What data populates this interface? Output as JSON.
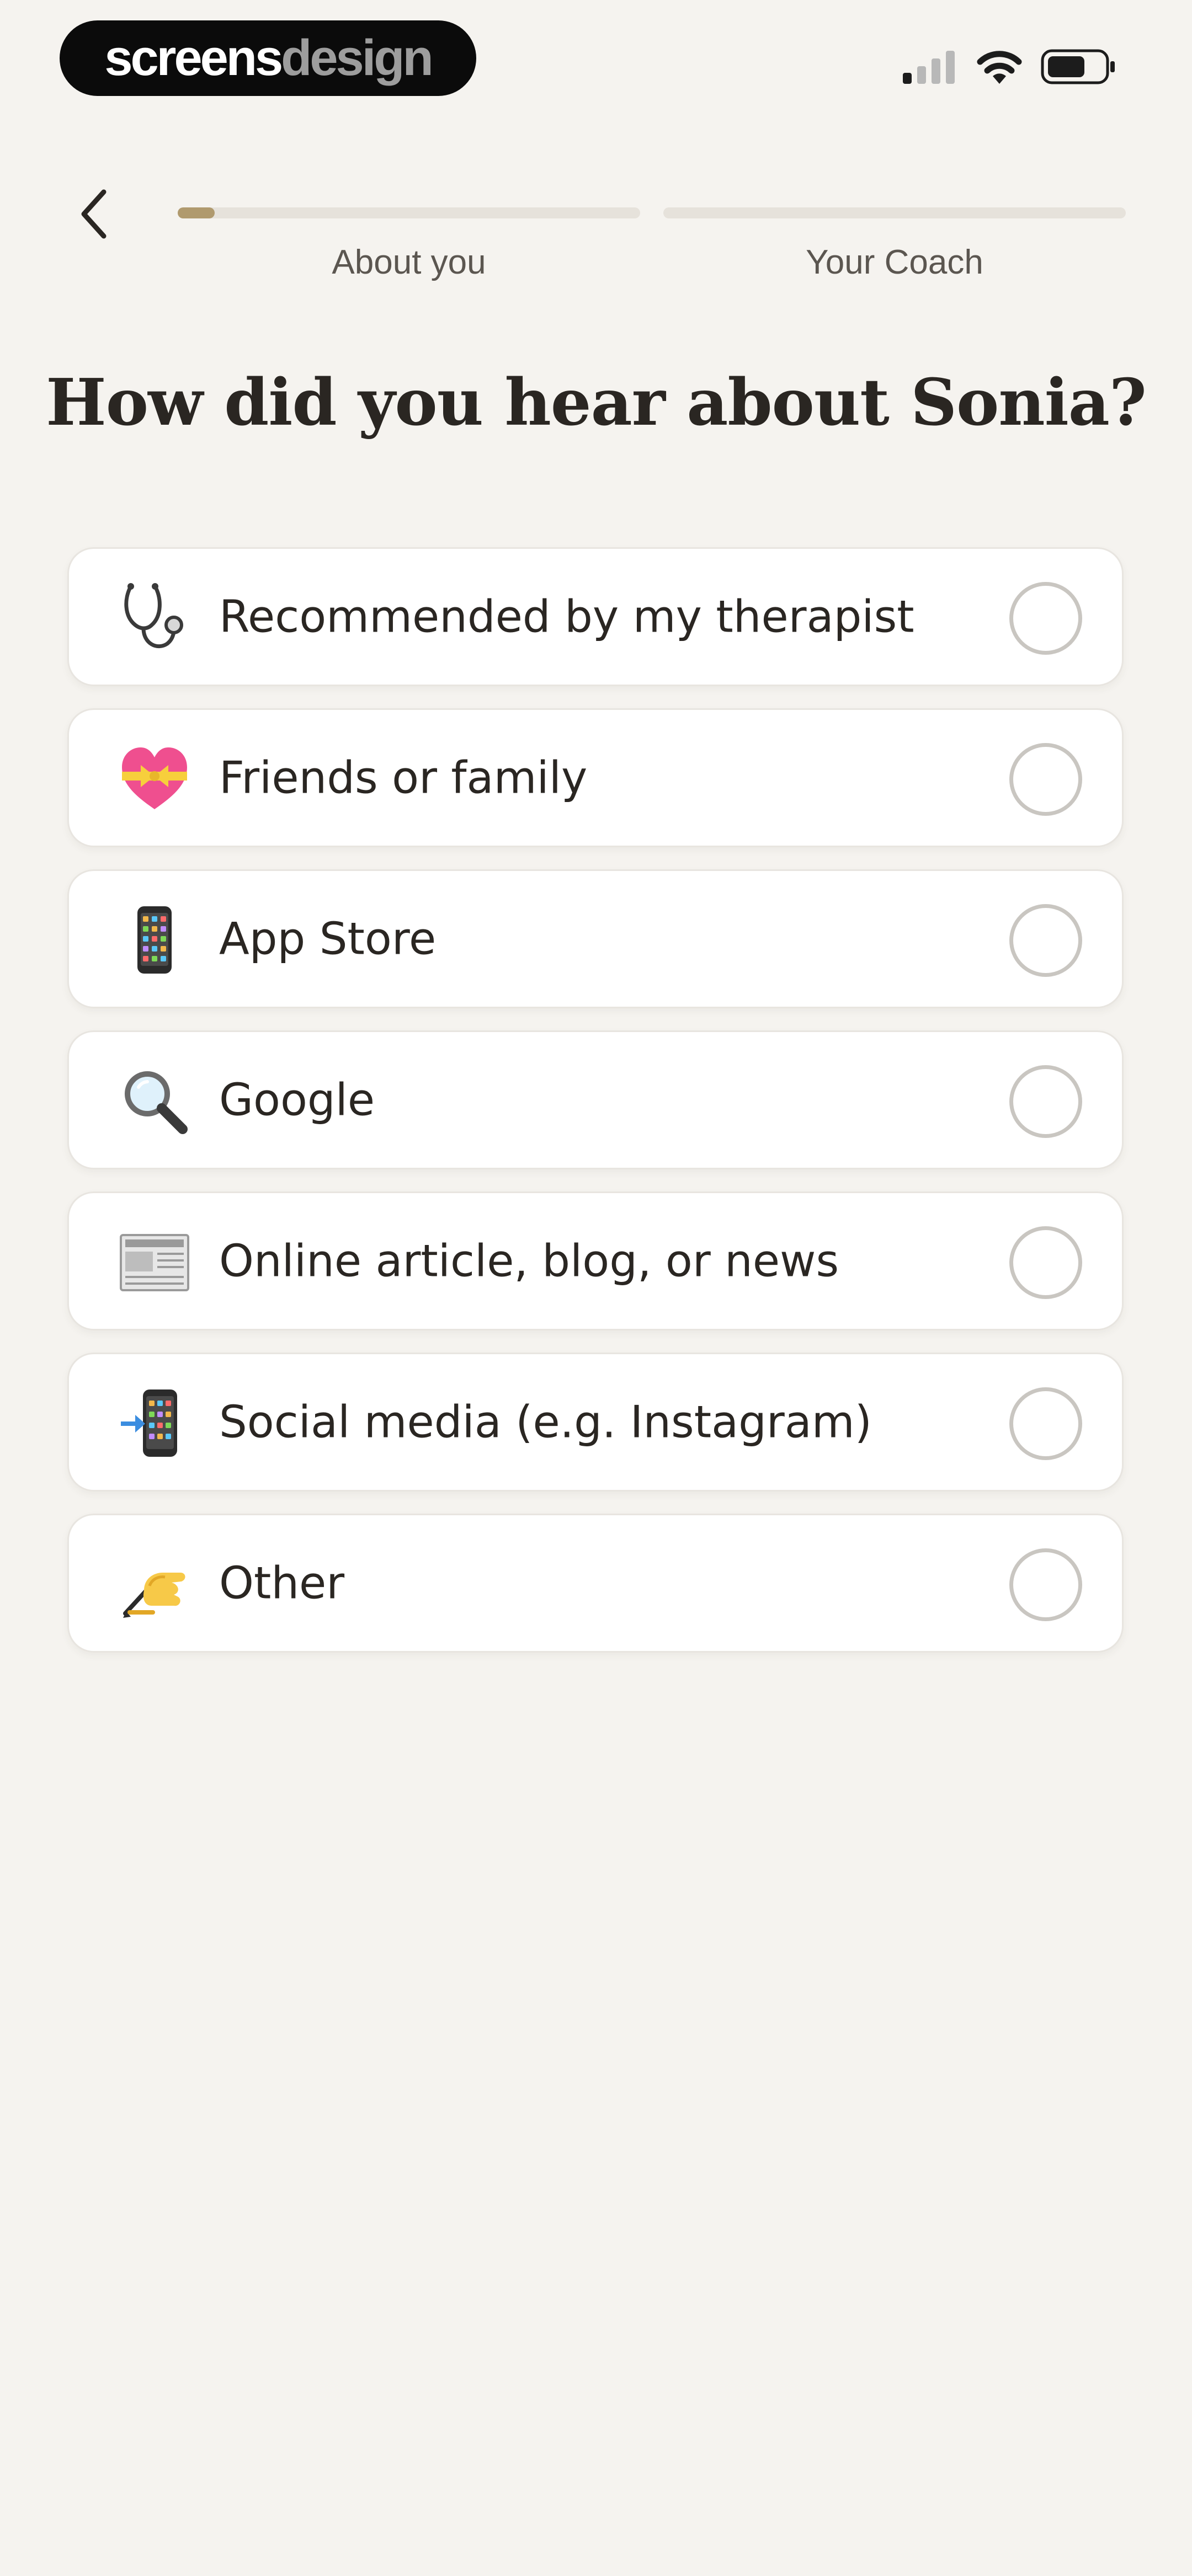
{
  "brand": {
    "part1": "screens",
    "part2": "design"
  },
  "header": {
    "steps": [
      {
        "label": "About you",
        "progress": 0.08
      },
      {
        "label": "Your Coach",
        "progress": 0
      }
    ],
    "accent_color": "#b09a6e"
  },
  "question": {
    "title": "How did you hear about Sonia?"
  },
  "options": [
    {
      "label": "Recommended by my therapist",
      "icon": "stethoscope-icon",
      "selected": false
    },
    {
      "label": "Friends or family",
      "icon": "heart-gift-icon",
      "selected": false
    },
    {
      "label": "App Store",
      "icon": "mobile-phone-icon",
      "selected": false
    },
    {
      "label": "Google",
      "icon": "magnifying-glass-icon",
      "selected": false
    },
    {
      "label": "Online article, blog, or news",
      "icon": "newspaper-icon",
      "selected": false
    },
    {
      "label": "Social media (e.g. Instagram)",
      "icon": "phone-arrow-icon",
      "selected": false
    },
    {
      "label": "Other",
      "icon": "writing-hand-icon",
      "selected": false
    }
  ]
}
